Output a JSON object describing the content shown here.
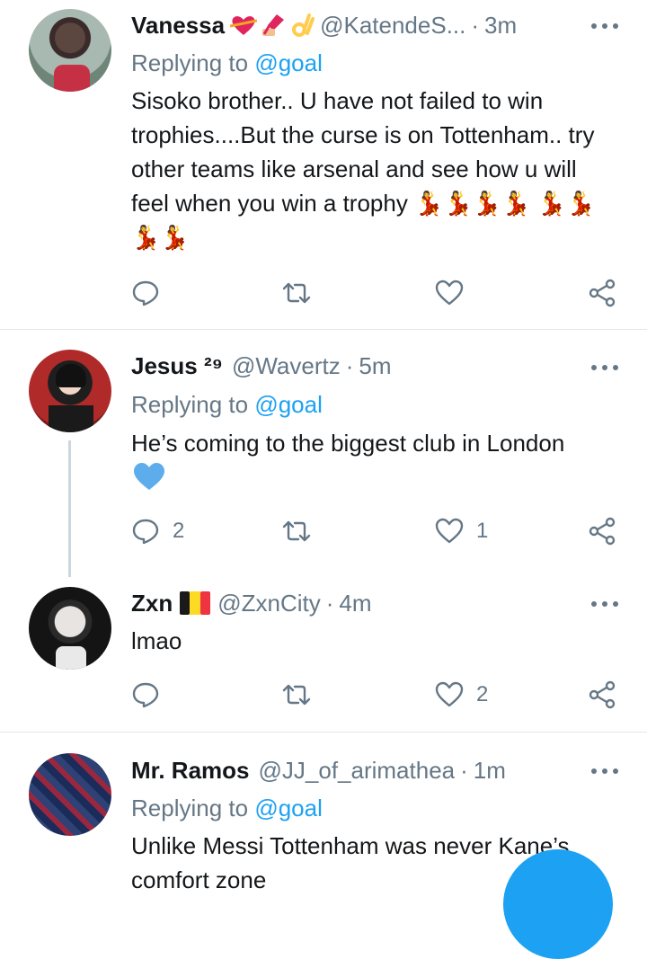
{
  "tweets": [
    {
      "name": "Vanessa",
      "handle": "@KatendeS...",
      "time": "3m",
      "replying_prefix": "Replying to",
      "replying_to": "@goal",
      "text": "Sisoko brother.. U have not failed to win trophies....But the curse is on Tottenham.. try other teams like arsenal and see how u will feel when you win a trophy 💃💃💃💃 💃💃💃💃",
      "counts": {
        "reply": "",
        "retweet": "",
        "like": ""
      }
    },
    {
      "name": "Jesus ²⁹",
      "handle": "@Wavertz",
      "time": "5m",
      "replying_prefix": "Replying to",
      "replying_to": "@goal",
      "text": "He’s coming to the biggest club in London",
      "counts": {
        "reply": "2",
        "retweet": "",
        "like": "1"
      }
    },
    {
      "name": "Zxn",
      "handle": "@ZxnCity",
      "time": "4m",
      "text": "lmao",
      "counts": {
        "reply": "",
        "retweet": "",
        "like": "2"
      }
    },
    {
      "name": "Mr. Ramos",
      "handle": "@JJ_of_arimathea",
      "time": "1m",
      "replying_prefix": "Replying to",
      "replying_to": "@goal",
      "text": "Unlike Messi Tottenham was never Kane’s comfort zone"
    }
  ],
  "colors": {
    "accent": "#1da1f2",
    "secondary_text": "#657786",
    "divider": "#e1e8ed"
  },
  "icons": [
    "reply-icon",
    "retweet-icon",
    "like-icon",
    "share-icon",
    "more-icon",
    "blue-heart-icon",
    "belgium-flag-icon",
    "heart-ribbon-icon",
    "nail-polish-icon",
    "ok-hand-icon",
    "dancer-icon"
  ]
}
